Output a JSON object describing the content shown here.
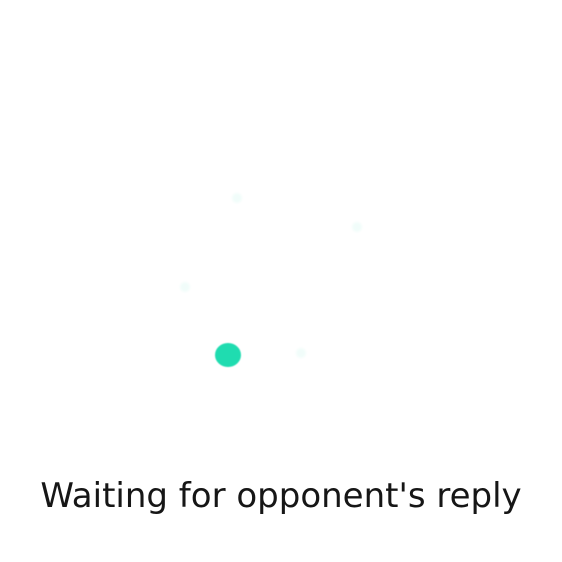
{
  "status": {
    "message": "Waiting for opponent's reply"
  },
  "colors": {
    "background": "#ffffff",
    "accent": "#1fdcb0",
    "text": "#161616"
  },
  "spinner": {
    "icon": "loading-spinner-icon"
  }
}
